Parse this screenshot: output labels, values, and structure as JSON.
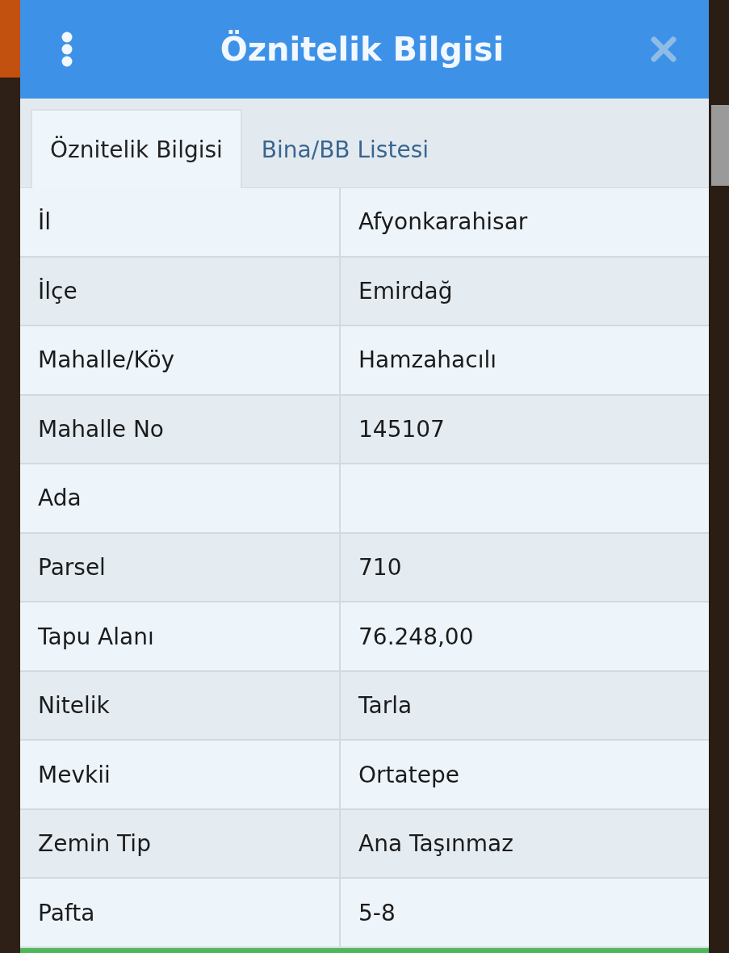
{
  "header": {
    "title": "Öznitelik Bilgisi"
  },
  "tabs": [
    {
      "label": "Öznitelik Bilgisi",
      "selected": true
    },
    {
      "label": "Bina/BB Listesi",
      "selected": false
    }
  ],
  "rows": [
    {
      "label": "İl",
      "value": "Afyonkarahisar"
    },
    {
      "label": "İlçe",
      "value": "Emirdağ"
    },
    {
      "label": "Mahalle/Köy",
      "value": "Hamzahacılı"
    },
    {
      "label": "Mahalle No",
      "value": "145107"
    },
    {
      "label": "Ada"
    },
    {
      "label": "Parsel",
      "value": "710"
    },
    {
      "label": "Tapu Alanı",
      "value": "76.248,00"
    },
    {
      "label": "Nitelik",
      "value": "Tarla"
    },
    {
      "label": "Mevkii",
      "value": "Ortatepe"
    },
    {
      "label": "Zemin Tip",
      "value": "Ana Taşınmaz"
    },
    {
      "label": "Pafta",
      "value": "5-8"
    }
  ]
}
